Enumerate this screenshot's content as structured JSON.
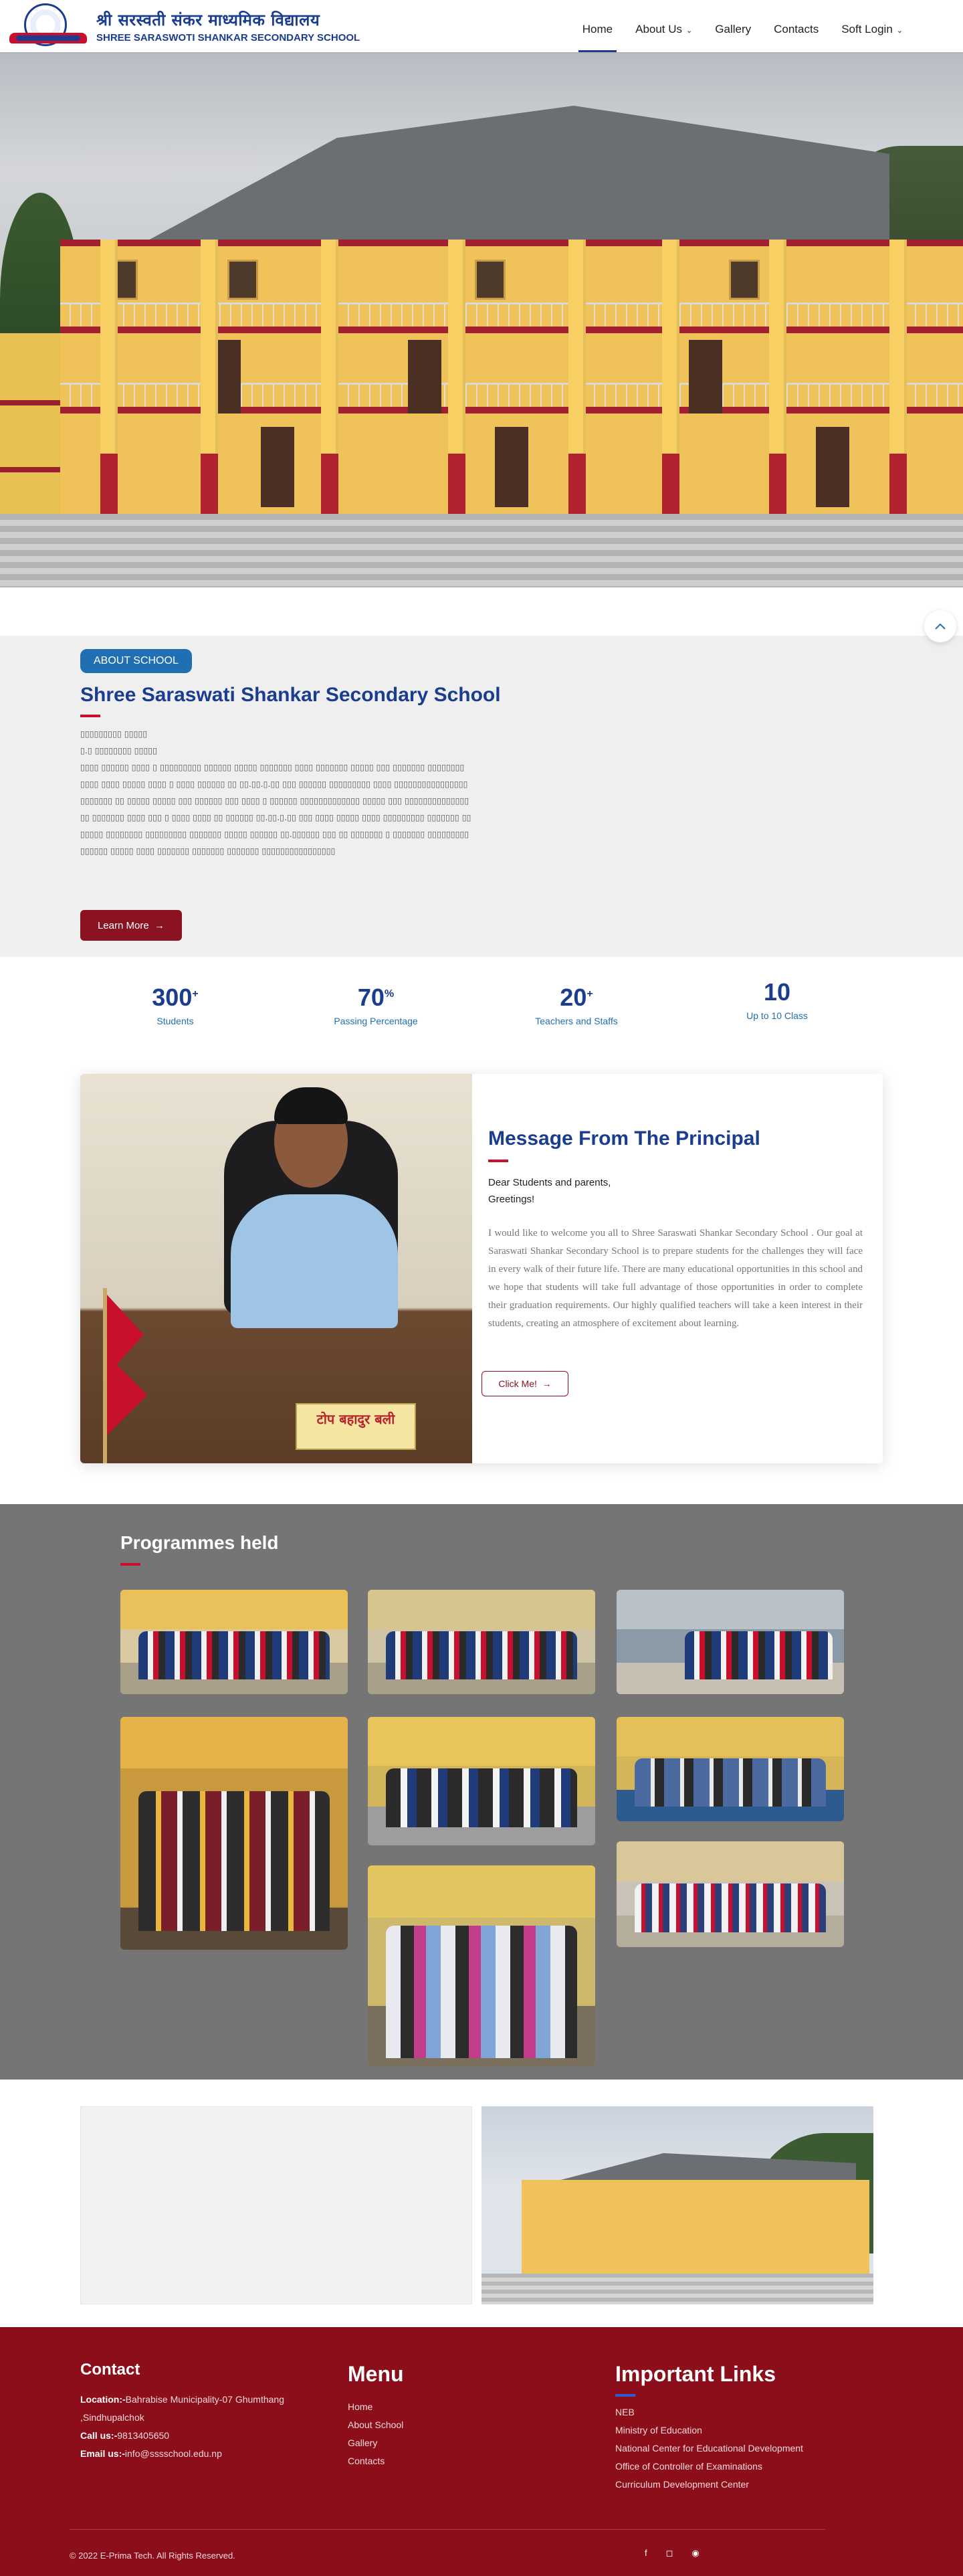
{
  "header": {
    "logo_np": "श्री सरस्वती संकर माध्यमिक विद्यालय",
    "logo_en": "SHREE SARASWOTI SHANKAR SECONDARY SCHOOL",
    "nav": [
      {
        "label": "Home",
        "active": true
      },
      {
        "label": "About Us",
        "dropdown": true
      },
      {
        "label": "Gallery"
      },
      {
        "label": "Contacts"
      },
      {
        "label": "Soft Login",
        "dropdown": true
      }
    ]
  },
  "about": {
    "badge": "ABOUT SCHOOL",
    "title": "Shree Saraswati Shankar Secondary School",
    "body_line1": "▯▯▯▯▯▯▯▯▯ ▯▯▯▯▯",
    "body_line2": "▯.▯ ▯▯▯▯▯▯▯▯ ▯▯▯▯▯",
    "body_para": "▯▯▯▯ ▯▯▯▯▯▯ ▯▯▯▯ ▯ ▯▯▯▯▯▯▯▯▯ ▯▯▯▯▯▯ ▯▯▯▯▯ ▯▯▯▯▯▯▯ ▯▯▯▯ ▯▯▯▯▯▯▯ ▯▯▯▯▯ ▯▯▯ ▯▯▯▯▯▯▯ ▯▯▯▯▯▯▯▯ ▯▯▯▯ ▯▯▯▯ ▯▯▯▯▯ ▯▯▯▯ ▯ ▯▯▯▯ ▯▯▯▯▯▯ ▯▯ ▯▯.▯▯.▯.▯▯ ▯▯▯ ▯▯▯▯▯▯ ▯▯▯▯▯▯▯▯▯ ▯▯▯▯ ▯▯▯▯▯▯▯▯▯▯▯▯▯▯▯▯▯▯▯▯▯▯▯ ▯▯ ▯▯▯▯▯ ▯▯▯▯▯ ▯▯▯ ▯▯▯▯▯▯ ▯▯▯ ▯▯▯▯ ▯ ▯▯▯▯▯▯ ▯▯▯▯▯▯▯▯▯▯▯▯▯ ▯▯▯▯▯ ▯▯▯ ▯▯▯▯▯▯▯▯▯▯▯▯▯▯▯▯ ▯▯▯▯▯▯▯ ▯▯▯▯ ▯▯▯ ▯ ▯▯▯▯ ▯▯▯▯ ▯▯ ▯▯▯▯▯▯ ▯▯.▯▯.▯.▯▯ ▯▯▯ ▯▯▯▯ ▯▯▯▯▯ ▯▯▯▯ ▯▯▯▯▯▯▯▯▯ ▯▯▯▯▯▯▯ ▯▯▯▯▯▯▯ ▯▯▯▯▯▯▯▯ ▯▯▯▯▯▯▯▯▯ ▯▯▯▯▯▯▯ ▯▯▯▯▯ ▯▯▯▯▯▯ ▯▯.▯▯▯▯▯▯ ▯▯▯ ▯▯ ▯▯▯▯▯▯▯ ▯ ▯▯▯▯▯▯▯ ▯▯▯▯▯▯▯▯▯▯▯▯▯▯▯ ▯▯▯▯▯ ▯▯▯▯ ▯▯▯▯▯▯▯ ▯▯▯▯▯▯▯ ▯▯▯▯▯▯▯ ▯▯▯▯▯▯▯▯▯▯▯▯▯▯▯▯",
    "button": "Learn More"
  },
  "stats": [
    {
      "value": "300",
      "suffix": "+",
      "label": "Students"
    },
    {
      "value": "70",
      "suffix": "%",
      "label": "Passing Percentage"
    },
    {
      "value": "20",
      "suffix": "+",
      "label": "Teachers and Staffs"
    },
    {
      "value": "10",
      "suffix": "",
      "label": "Up to 10 Class"
    }
  ],
  "principal": {
    "title": "Message From The Principal",
    "greeting_1": "Dear Students and parents,",
    "greeting_2": "Greetings!",
    "message": "I would like to welcome you all to Shree Saraswati Shankar Secondary School . Our goal at Saraswati Shankar Secondary School is to prepare students for the challenges they will face in every walk of their future life. There are many educational opportunities in this school and we hope that students will take full advantage of those opportunities in order to complete their graduation requirements. Our highly qualified teachers will take a keen interest in their students, creating an atmosphere of excitement about learning.",
    "nameplate": "टोप बहादुर बली",
    "button": "Click Me!"
  },
  "programmes": {
    "title": "Programmes held"
  },
  "footer": {
    "contact_title": "Contact",
    "location_label": "Location:-",
    "location_value": "Bahrabise Municipality-07 Ghumthang ,Sindhupalchok",
    "call_label": "Call us:-",
    "call_value": "9813405650",
    "email_label": "Email us:-",
    "email_value": "info@sssschool.edu.np",
    "menu_title": "Menu",
    "menu": [
      "Home",
      "About School",
      "Gallery",
      "Contacts"
    ],
    "links_title": "Important Links",
    "links": [
      "NEB",
      "Ministry of Education",
      " National Center for Educational Development",
      "Office of Controller of Examinations",
      "Curriculum Development Center"
    ],
    "copyright": "© 2022 E-Prima Tech. All Rights Reserved."
  }
}
